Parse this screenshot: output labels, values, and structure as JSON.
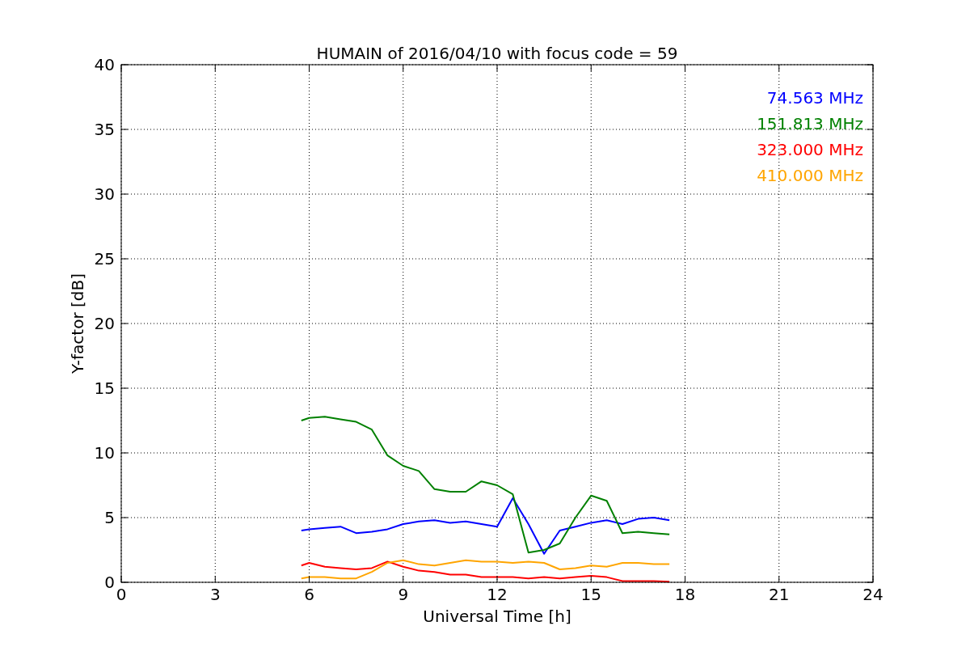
{
  "figure": {
    "chart_data": {
      "type": "line",
      "grid": true,
      "title": "HUMAIN of 2016/04/10 with focus code = 59",
      "xlabel": "Universal Time [h]",
      "ylabel": "Y-factor [dB]",
      "xlim": [
        0,
        24
      ],
      "ylim": [
        0,
        40
      ],
      "xticks": [
        0,
        3,
        6,
        9,
        12,
        15,
        18,
        21,
        24
      ],
      "yticks": [
        0,
        5,
        10,
        15,
        20,
        25,
        30,
        35,
        40
      ],
      "x": [
        5.75,
        6,
        6.5,
        7,
        7.5,
        8,
        8.5,
        9,
        9.5,
        10,
        10.5,
        11,
        11.5,
        12,
        12.5,
        13,
        13.5,
        14,
        14.5,
        15,
        15.5,
        16,
        16.5,
        17,
        17.5
      ],
      "series": [
        {
          "name": "74.563 MHz",
          "color": "#0000ff",
          "values": [
            4.0,
            4.1,
            4.2,
            4.3,
            3.8,
            3.9,
            4.1,
            4.5,
            4.7,
            4.8,
            4.6,
            4.7,
            4.5,
            4.3,
            6.5,
            4.5,
            2.2,
            4.0,
            4.3,
            4.6,
            4.8,
            4.5,
            4.9,
            5.0,
            4.8
          ]
        },
        {
          "name": "151.813 MHz",
          "color": "#008000",
          "values": [
            12.5,
            12.7,
            12.8,
            12.6,
            12.4,
            11.8,
            9.8,
            9.0,
            8.6,
            7.2,
            7.0,
            7.0,
            7.8,
            7.5,
            6.8,
            2.3,
            2.5,
            3.0,
            5.0,
            6.7,
            6.3,
            3.8,
            3.9,
            3.8,
            3.7
          ]
        },
        {
          "name": "323.000 MHz",
          "color": "#ff0000",
          "values": [
            1.3,
            1.5,
            1.2,
            1.1,
            1.0,
            1.1,
            1.6,
            1.2,
            0.9,
            0.8,
            0.6,
            0.6,
            0.4,
            0.4,
            0.4,
            0.3,
            0.4,
            0.3,
            0.4,
            0.5,
            0.4,
            0.1,
            0.1,
            0.1,
            0.05
          ]
        },
        {
          "name": "410.000 MHz",
          "color": "#ffa500",
          "values": [
            0.3,
            0.4,
            0.4,
            0.3,
            0.3,
            0.8,
            1.5,
            1.7,
            1.4,
            1.3,
            1.5,
            1.7,
            1.6,
            1.6,
            1.5,
            1.6,
            1.5,
            1.0,
            1.1,
            1.3,
            1.2,
            1.5,
            1.5,
            1.4,
            1.4
          ]
        }
      ]
    }
  }
}
